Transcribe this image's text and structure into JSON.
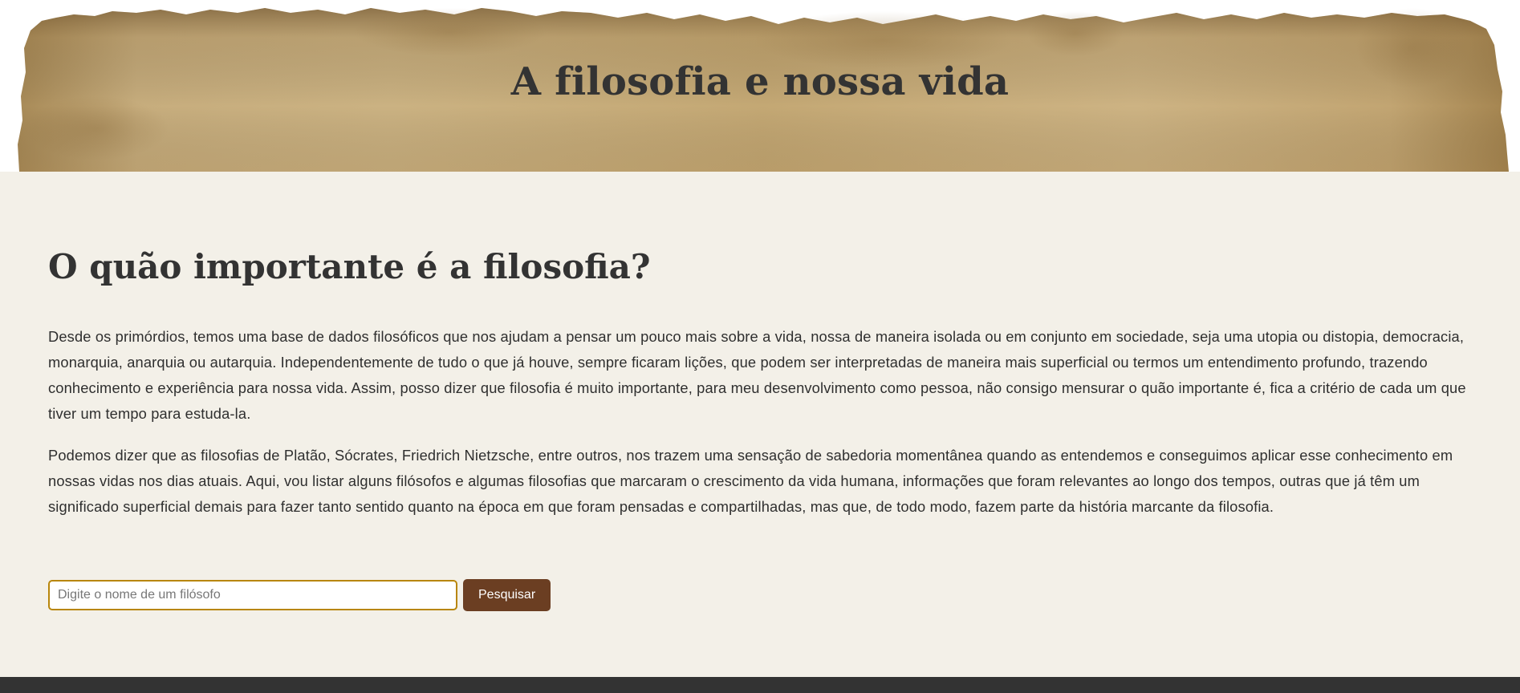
{
  "header": {
    "title": "A filosofia e nossa vida"
  },
  "main": {
    "heading": "O quão importante é a filosofia?",
    "paragraphs": [
      "Desde os primórdios, temos uma base de dados filosóficos que nos ajudam a pensar um pouco mais sobre a vida, nossa de maneira isolada ou em conjunto em sociedade, seja uma utopia ou distopia, democracia, monarquia, anarquia ou autarquia. Independentemente de tudo o que já houve, sempre ficaram lições, que podem ser interpretadas de maneira mais superficial ou termos um entendimento profundo, trazendo conhecimento e experiência para nossa vida. Assim, posso dizer que filosofia é muito importante, para meu desenvolvimento como pessoa, não consigo mensurar o quão importante é, fica a critério de cada um que tiver um tempo para estuda-la.",
      "Podemos dizer que as filosofias de Platão, Sócrates, Friedrich Nietzsche, entre outros, nos trazem uma sensação de sabedoria momentânea quando as entendemos e conseguimos aplicar esse conhecimento em nossas vidas nos dias atuais. Aqui, vou listar alguns filósofos e algumas filosofias que marcaram o crescimento da vida humana, informações que foram relevantes ao longo dos tempos, outras que já têm um significado superficial demais para fazer tanto sentido quanto na época em que foram pensadas e compartilhadas, mas que, de todo modo, fazem parte da história marcante da filosofia."
    ]
  },
  "search": {
    "value": "",
    "placeholder": "Digite o nome de um filósofo",
    "button_label": "Pesquisar"
  },
  "colors": {
    "background": "#f3f0e8",
    "text": "#333333",
    "button": "#6b3e22",
    "input_border": "#b8860b",
    "footer": "#333333",
    "parchment": "#c9ae7c"
  }
}
